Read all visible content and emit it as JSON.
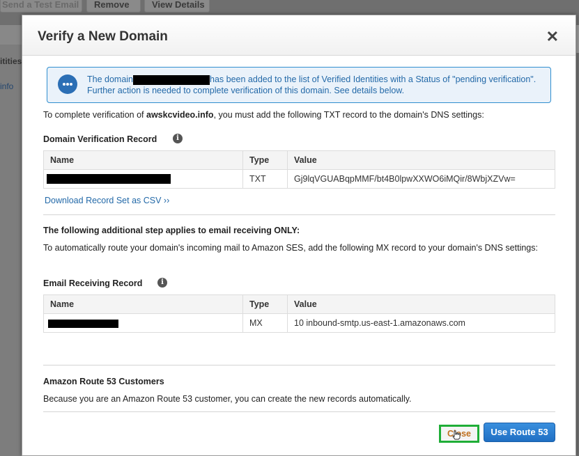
{
  "background": {
    "toolbar_buttons": [
      "Send a Test Email",
      "Remove",
      "View Details"
    ],
    "sidebar_items": [
      "itities",
      "info"
    ]
  },
  "modal": {
    "title": "Verify a New Domain",
    "close_symbol": "✕",
    "info": {
      "icon": "chat-bubble-icon",
      "text_before": "The domain",
      "text_after": "has been added to the list of Verified Identities with a Status of \"pending verification\". Further action is needed to complete verification of this domain. See details below."
    },
    "txt_intro_before": "To complete verification of ",
    "txt_intro_domain": "awskcvideo.info",
    "txt_intro_after": ", you must add the following TXT record to the domain's DNS settings:",
    "domain_verification": {
      "label": "Domain Verification Record",
      "columns": [
        "Name",
        "Type",
        "Value"
      ],
      "row": {
        "type": "TXT",
        "value": "Gj9lqVGUABqpMMF/bt4B0lpwXXWO6iMQir/8WbjXZVw="
      }
    },
    "download_link": "Download Record Set as CSV ››",
    "email_step_heading": "The following additional step applies to email receiving ONLY:",
    "email_step_text": "To automatically route your domain's incoming mail to Amazon SES, add the following MX record to your domain's DNS settings:",
    "email_receiving": {
      "label": "Email Receiving Record",
      "columns": [
        "Name",
        "Type",
        "Value"
      ],
      "row": {
        "type": "MX",
        "value": "10 inbound-smtp.us-east-1.amazonaws.com"
      }
    },
    "route53_heading": "Amazon Route 53 Customers",
    "route53_text": "Because you are an Amazon Route 53 customer, you can create the new records automatically.",
    "buttons": {
      "close": "Close",
      "use_route53": "Use Route 53"
    },
    "colors": {
      "accent": "#1f6fc3",
      "info_text": "#2369a8",
      "highlight": "#1fae37"
    }
  }
}
